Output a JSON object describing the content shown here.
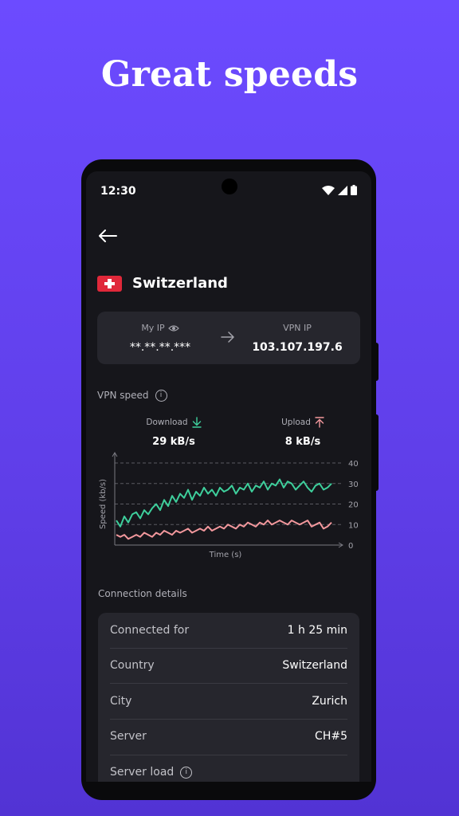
{
  "headline": "Great speeds",
  "status_bar": {
    "time": "12:30"
  },
  "location": {
    "name": "Switzerland"
  },
  "ip": {
    "my_ip_label": "My IP",
    "my_ip_value": "**.**.**.***",
    "vpn_ip_label": "VPN IP",
    "vpn_ip_value": "103.107.197.6"
  },
  "vpn_speed": {
    "label": "VPN speed",
    "download_label": "Download",
    "download_value": "29 kB/s",
    "upload_label": "Upload",
    "upload_value": "8 kB/s"
  },
  "colors": {
    "download": "#3ecf9c",
    "upload": "#f3989d",
    "background": "#6c4bff"
  },
  "chart_data": {
    "type": "line",
    "xlabel": "Time (s)",
    "ylabel": "Speed (kb/s)",
    "ylim": [
      0,
      40
    ],
    "yticks": [
      "0",
      "10",
      "20",
      "30",
      "40"
    ],
    "grid": "dashed horizontal",
    "series": [
      {
        "name": "Download",
        "values": [
          12,
          9,
          14,
          11,
          15,
          16,
          13,
          17,
          15,
          18,
          20,
          17,
          22,
          19,
          24,
          21,
          25,
          23,
          27,
          22,
          26,
          24,
          28,
          25,
          27,
          24,
          28,
          26,
          27,
          29,
          25,
          28,
          27,
          30,
          26,
          29,
          28,
          31,
          27,
          30,
          29,
          32,
          28,
          31,
          30,
          27,
          29,
          31,
          28,
          26,
          29,
          30,
          27,
          28,
          30
        ]
      },
      {
        "name": "Upload",
        "values": [
          5,
          4,
          5,
          3,
          4,
          5,
          4,
          6,
          5,
          4,
          6,
          5,
          7,
          6,
          5,
          7,
          6,
          7,
          8,
          6,
          7,
          8,
          7,
          9,
          7,
          8,
          9,
          8,
          10,
          9,
          8,
          10,
          9,
          11,
          10,
          9,
          11,
          10,
          12,
          10,
          11,
          12,
          11,
          10,
          12,
          11,
          10,
          11,
          12,
          9,
          10,
          11,
          8,
          9,
          11
        ]
      }
    ]
  },
  "connection_details": {
    "label": "Connection details",
    "rows": [
      {
        "key": "Connected for",
        "value": "1 h 25 min"
      },
      {
        "key": "Country",
        "value": "Switzerland"
      },
      {
        "key": "City",
        "value": "Zurich"
      },
      {
        "key": "Server",
        "value": "CH#5"
      },
      {
        "key": "Server load",
        "value": ""
      }
    ]
  }
}
